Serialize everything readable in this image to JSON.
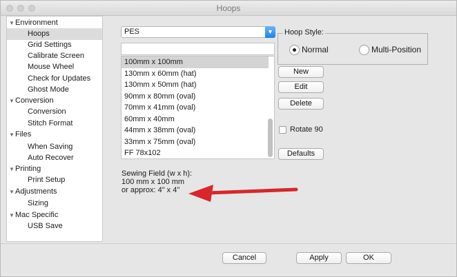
{
  "window": {
    "title": "Hoops"
  },
  "sidebar": {
    "items": [
      {
        "label": "Environment",
        "type": "group"
      },
      {
        "label": "Hoops",
        "type": "child",
        "selected": true
      },
      {
        "label": "Grid Settings",
        "type": "child"
      },
      {
        "label": "Calibrate Screen",
        "type": "child"
      },
      {
        "label": "Mouse Wheel",
        "type": "child"
      },
      {
        "label": "Check for Updates",
        "type": "child"
      },
      {
        "label": "Ghost Mode",
        "type": "child"
      },
      {
        "label": "Conversion",
        "type": "group"
      },
      {
        "label": "Conversion",
        "type": "child"
      },
      {
        "label": "Stitch Format",
        "type": "child"
      },
      {
        "label": "Files",
        "type": "group"
      },
      {
        "label": "When Saving",
        "type": "child"
      },
      {
        "label": "Auto Recover",
        "type": "child"
      },
      {
        "label": "Printing",
        "type": "group"
      },
      {
        "label": "Print Setup",
        "type": "child"
      },
      {
        "label": "Adjustments",
        "type": "group"
      },
      {
        "label": "Sizing",
        "type": "child"
      },
      {
        "label": "Mac Specific",
        "type": "group"
      },
      {
        "label": "USB Save",
        "type": "child"
      }
    ]
  },
  "format_select": {
    "value": "PES",
    "arrow_icon": "chevron-down-icon"
  },
  "search_field": {
    "value": ""
  },
  "hoop_list": {
    "items": [
      "100mm x 100mm",
      "130mm x 60mm (hat)",
      "130mm x 50mm (hat)",
      "90mm x 80mm (oval)",
      "70mm x 41mm (oval)",
      "60mm x 40mm",
      "44mm x 38mm (oval)",
      "33mm x 75mm (oval)",
      "FF 78x102"
    ],
    "selected_index": 0
  },
  "sewing_field": {
    "heading": "Sewing Field (w x h):",
    "size": "100 mm x 100 mm",
    "approx": "or approx: 4\" x 4\""
  },
  "hoop_style": {
    "title": "Hoop Style:",
    "options": [
      {
        "label": "Normal",
        "selected": true
      },
      {
        "label": "Multi-Position",
        "selected": false
      }
    ]
  },
  "buttons": {
    "new": "New",
    "edit": "Edit",
    "delete": "Delete",
    "defaults": "Defaults",
    "cancel": "Cancel",
    "apply": "Apply",
    "ok": "OK"
  },
  "rotate": {
    "label": "Rotate 90",
    "checked": false
  },
  "annotation": {
    "color": "#d8262b"
  },
  "colors": {
    "accent": "#1a82f2",
    "selection": "#d4d4d4"
  }
}
